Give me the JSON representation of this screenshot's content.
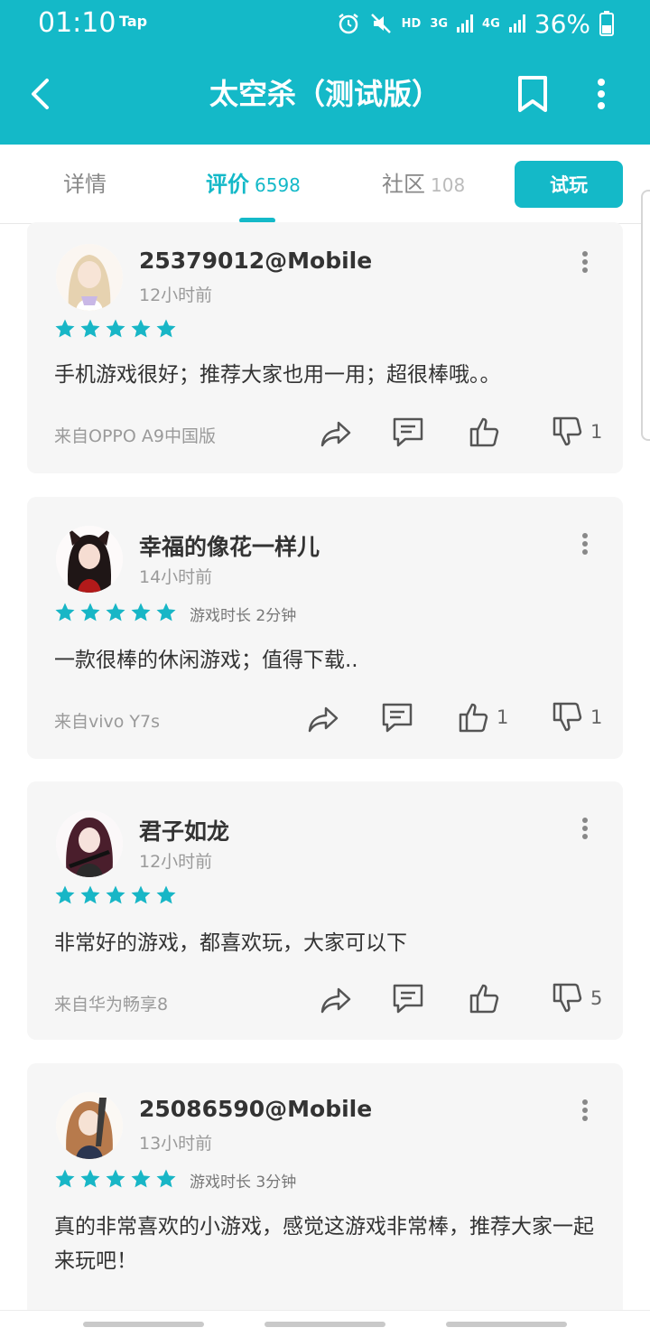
{
  "status_bar": {
    "time": "01:10",
    "app_badge": "Tap",
    "hd": "HD",
    "net1": "3G",
    "net2": "4G",
    "battery": "36%"
  },
  "header": {
    "title": "太空杀（测试版）"
  },
  "tabs": [
    {
      "label": "详情",
      "count": ""
    },
    {
      "label": "评价",
      "count": "6598"
    },
    {
      "label": "社区",
      "count": "108"
    }
  ],
  "try_button": "试玩",
  "colors": {
    "accent": "#14b9c8",
    "star": "#18b6c6",
    "card_bg": "#f6f6f6"
  },
  "reviews": [
    {
      "user": "25379012@Mobile",
      "time": "12小时前",
      "stars": 5,
      "playtime": "",
      "text": "手机游戏很好；推荐大家也用一用；超很棒哦。。",
      "device": "来自OPPO A9中国版",
      "likes": "",
      "dislikes": "1"
    },
    {
      "user": "幸福的像花一样儿",
      "time": "14小时前",
      "stars": 5,
      "playtime": "游戏时长 2分钟",
      "text": "一款很棒的休闲游戏；值得下载..",
      "device": "来自vivo Y7s",
      "likes": "1",
      "dislikes": "1"
    },
    {
      "user": "君子如龙",
      "time": "12小时前",
      "stars": 5,
      "playtime": "",
      "text": "非常好的游戏，都喜欢玩，大家可以下",
      "device": "来自华为畅享8",
      "likes": "",
      "dislikes": "5"
    },
    {
      "user": "25086590@Mobile",
      "time": "13小时前",
      "stars": 5,
      "playtime": "游戏时长 3分钟",
      "text": "真的非常喜欢的小游戏，感觉这游戏非常棒，推荐大家一起来玩吧！",
      "device": "",
      "likes": "",
      "dislikes": ""
    }
  ]
}
